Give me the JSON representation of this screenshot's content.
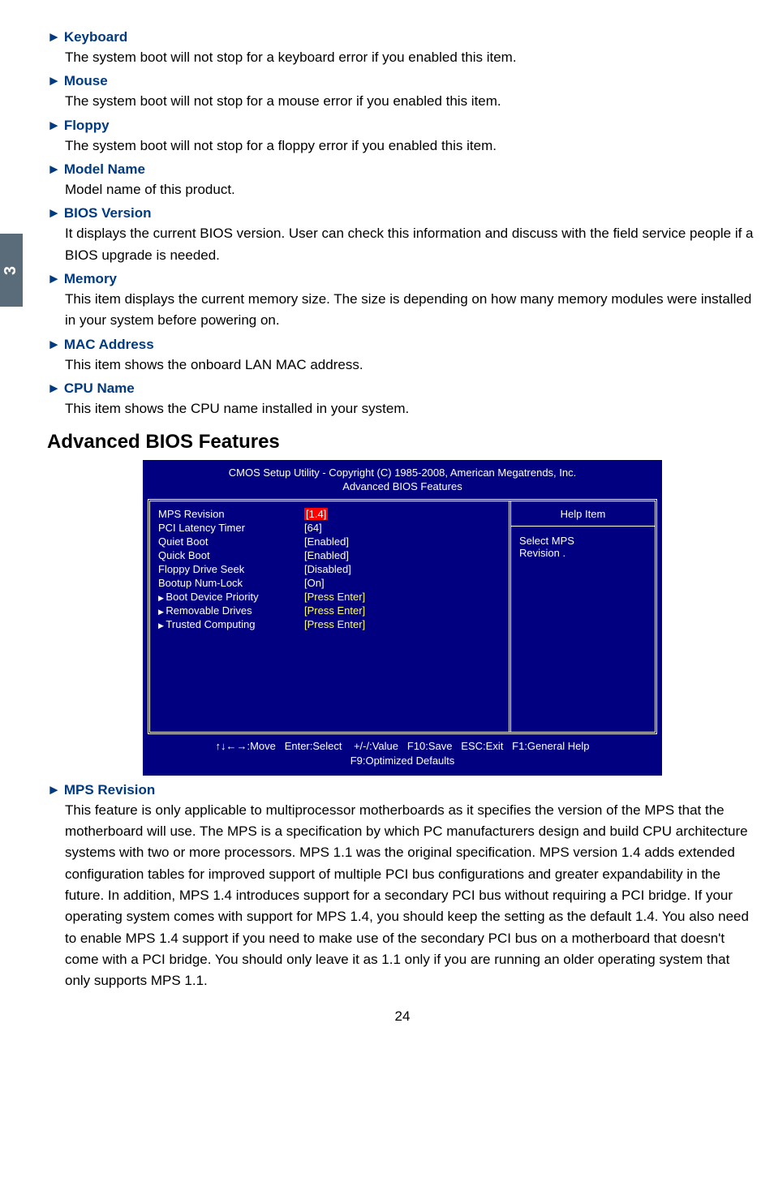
{
  "sideTab": "3",
  "items_top": [
    {
      "title": "Keyboard",
      "desc": "The system boot will not stop for a keyboard error if you enabled this item."
    },
    {
      "title": "Mouse",
      "desc": "The system boot will not stop for a mouse error if you enabled this item."
    },
    {
      "title": "Floppy",
      "desc": "The system boot will not stop for a floppy error if you enabled this item."
    },
    {
      "title": "Model Name",
      "desc": "Model name of this product."
    },
    {
      "title": "BIOS Version",
      "desc": "It displays the current BIOS version. User can check this information and discuss with the field service people if a BIOS upgrade is needed."
    },
    {
      "title": "Memory",
      "desc": "This item displays the current memory size. The size is depending on how many memory modules were installed in your system before powering on."
    },
    {
      "title": "MAC Address",
      "desc": "This item shows the onboard LAN MAC address."
    },
    {
      "title": "CPU Name",
      "desc": "This item shows the CPU name installed in your system."
    }
  ],
  "section_title": "Advanced BIOS Features",
  "bios": {
    "title1": "CMOS Setup Utility - Copyright (C) 1985-2008, American Megatrends, Inc.",
    "title2": "Advanced BIOS Features",
    "rows": [
      {
        "label": "MPS Revision",
        "val": "[1.4]",
        "valClass": "highlight",
        "sub": false
      },
      {
        "label": "PCI Latency Timer",
        "val": "[64]",
        "valClass": "",
        "sub": false
      },
      {
        "label": "Quiet Boot",
        "val": "[Enabled]",
        "valClass": "",
        "sub": false
      },
      {
        "label": "Quick Boot",
        "val": "[Enabled]",
        "valClass": "",
        "sub": false
      },
      {
        "label": "Floppy Drive Seek",
        "val": "[Disabled]",
        "valClass": "",
        "sub": false
      },
      {
        "label": "Bootup Num-Lock",
        "val": "[On]",
        "valClass": "",
        "sub": false
      },
      {
        "label": "Boot Device Priority",
        "val": "[Press Enter]",
        "valClass": "yellow",
        "sub": true
      },
      {
        "label": "Removable Drives",
        "val": "[Press Enter]",
        "valClass": "yellow",
        "sub": true
      },
      {
        "label": "Trusted Computing",
        "val": "[Press Enter]",
        "valClass": "yellow",
        "sub": true
      }
    ],
    "help_title": "Help Item",
    "help_body1": "Select MPS",
    "help_body2": "Revision .",
    "footer1": "↑↓←→:Move   Enter:Select    +/-/:Value   F10:Save   ESC:Exit   F1:General Help",
    "footer2": "F9:Optimized Defaults"
  },
  "items_bottom": [
    {
      "title": "MPS Revision",
      "desc": "This feature is only applicable to multiprocessor motherboards as it specifies the version of the MPS that the motherboard will use. The MPS is a specification by which PC manufacturers design and build CPU architecture systems with two or more processors. MPS 1.1 was the original specification. MPS version 1.4 adds extended configuration tables for improved support of multiple PCI bus configurations and greater expandability in the future. In addition, MPS 1.4 introduces support for a secondary PCI bus without requiring a PCI bridge. If your operating system comes with support for MPS 1.4, you should keep the setting as the default 1.4. You also need to enable MPS 1.4 support if you need to make use of the secondary PCI bus on a motherboard that doesn't come with a PCI bridge. You should only leave it as 1.1 only if you are running an older operating system that only supports MPS 1.1."
    }
  ],
  "pageNum": "24"
}
